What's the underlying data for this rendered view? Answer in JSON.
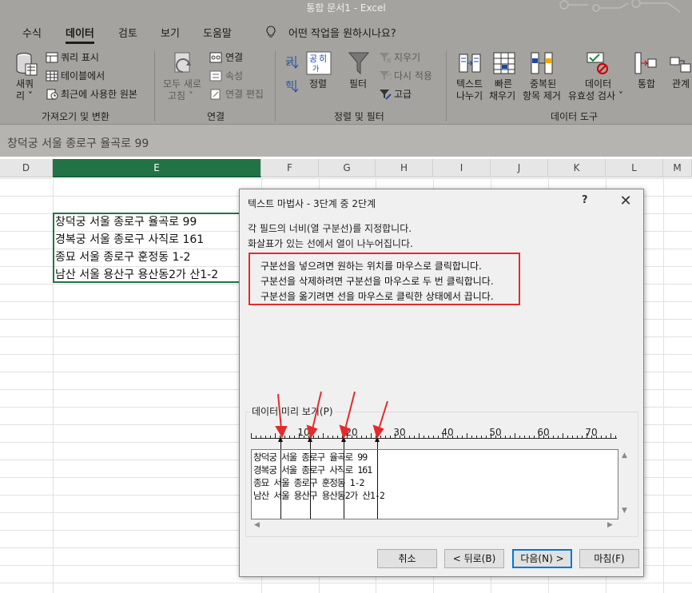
{
  "titlebar": {
    "text": "통합 문서1  -  Excel"
  },
  "tabs": [
    {
      "label": "수식"
    },
    {
      "label": "데이터"
    },
    {
      "label": "검토"
    },
    {
      "label": "보기"
    },
    {
      "label": "도움말"
    }
  ],
  "tellme": {
    "text": "어떤 작업을 원하시나요?"
  },
  "ribbon": {
    "get_transform": {
      "new_query_line1": "새쿼",
      "new_query_line2": "리 ˅",
      "show_queries": "쿼리 표시",
      "from_table": "테이블에서",
      "recent_sources": "최근에 사용한 원본",
      "group_label": "가져오기 및 변환"
    },
    "connections": {
      "refresh_line1": "모두 새로",
      "refresh_line2": "고침 ˅",
      "connections": "연결",
      "properties": "속성",
      "edit_links": "연결 편집",
      "group_label": "연결"
    },
    "sort_filter": {
      "sort": "정렬",
      "filter": "필터",
      "clear": "지우기",
      "reapply": "다시 적용",
      "advanced": "고급",
      "group_label": "정렬 및 필터"
    },
    "data_tools": {
      "text_to_columns_line1": "텍스트",
      "text_to_columns_line2": "나누기",
      "flash_fill_line1": "빠른",
      "flash_fill_line2": "채우기",
      "remove_dup_line1": "중복된",
      "remove_dup_line2": "항목 제거",
      "validation_line1": "데이터",
      "validation_line2": "유효성 검사 ˅",
      "consolidate": "통합",
      "relationships": "관계",
      "group_label": "데이터 도구"
    }
  },
  "formula_bar": {
    "text": "창덕궁 서울 종로구 율곡로 99"
  },
  "columns": [
    "D",
    "E",
    "F",
    "G",
    "H",
    "I",
    "J",
    "K",
    "L",
    "M"
  ],
  "cells": [
    "창덕궁 서울 종로구 율곡로 99",
    "경복궁 서울 종로구 사직로 161",
    "종묘 서울 종로구 훈정동 1-2",
    "남산 서울 용산구 용산동2가 산1-2"
  ],
  "dialog": {
    "title": "텍스트 마법사 - 3단계 중 2단계",
    "help": "?",
    "close": "✕",
    "desc1": "각 필드의 너비(열 구분선)를 지정합니다.",
    "desc2": "화살표가 있는 선에서 열이 나누어집니다.",
    "info": [
      "구분선을 넣으려면 원하는 위치를 마우스로 클릭합니다.",
      "구분선을 삭제하려면 구분선을 마우스로 두 번 클릭합니다.",
      "구분선을 옮기려면 선을 마우스로 클릭한 상태에서 끕니다."
    ],
    "preview_label": "데이터 미리 보기(P)",
    "ruler_labels": [
      "10",
      "20",
      "30",
      "40",
      "50",
      "60",
      "70"
    ],
    "preview_rows": [
      "창덕궁 서울 종로구 율곡로 99",
      "경복궁 서울 종로구 사직로 161",
      "종묘 서울 종로구 훈정동 1-2",
      "남산 서울 용산구 용산동2가 산1-2"
    ],
    "buttons": {
      "cancel": "취소",
      "back": "< 뒤로(B)",
      "next": "다음(N) >",
      "finish": "마침(F)"
    }
  },
  "colors": {
    "ribbon_bg": "#a5a3a0",
    "accent": "#217346",
    "highlight_red": "#e32b2b",
    "dialog_default_button": "#0078d7"
  }
}
